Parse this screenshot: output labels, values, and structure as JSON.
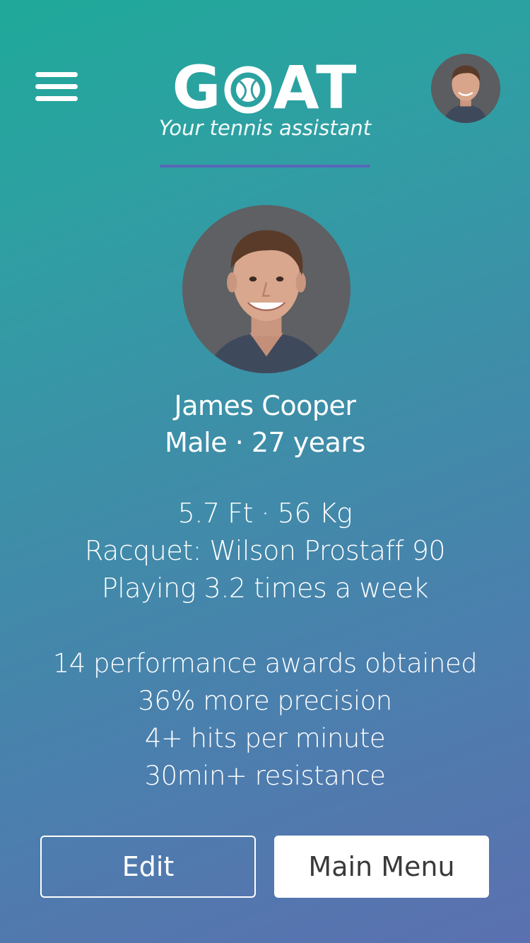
{
  "header": {
    "logo_text_left": "G",
    "logo_text_right": "AT",
    "tagline": "Your tennis assistant",
    "rule_color": "#5867b8"
  },
  "profile": {
    "name": "James Cooper",
    "gender_age": "Male · 27 years",
    "body": "5.7 Ft · 56 Kg",
    "racquet": "Racquet: Wilson Prostaff 90",
    "frequency": "Playing 3.2 times a week"
  },
  "stats": [
    "14 performance awards obtained",
    "36% more precision",
    "4+ hits per minute",
    "30min+ resistance"
  ],
  "buttons": {
    "edit": "Edit",
    "main_menu": "Main Menu"
  },
  "icons": {
    "menu": "hamburger-menu-icon",
    "logo_ball": "tennis-ball-icon"
  },
  "colors": {
    "gradient_top": "#1fa99a",
    "gradient_bottom": "#5b70b0",
    "button_text_dark": "#3a3a3a"
  }
}
